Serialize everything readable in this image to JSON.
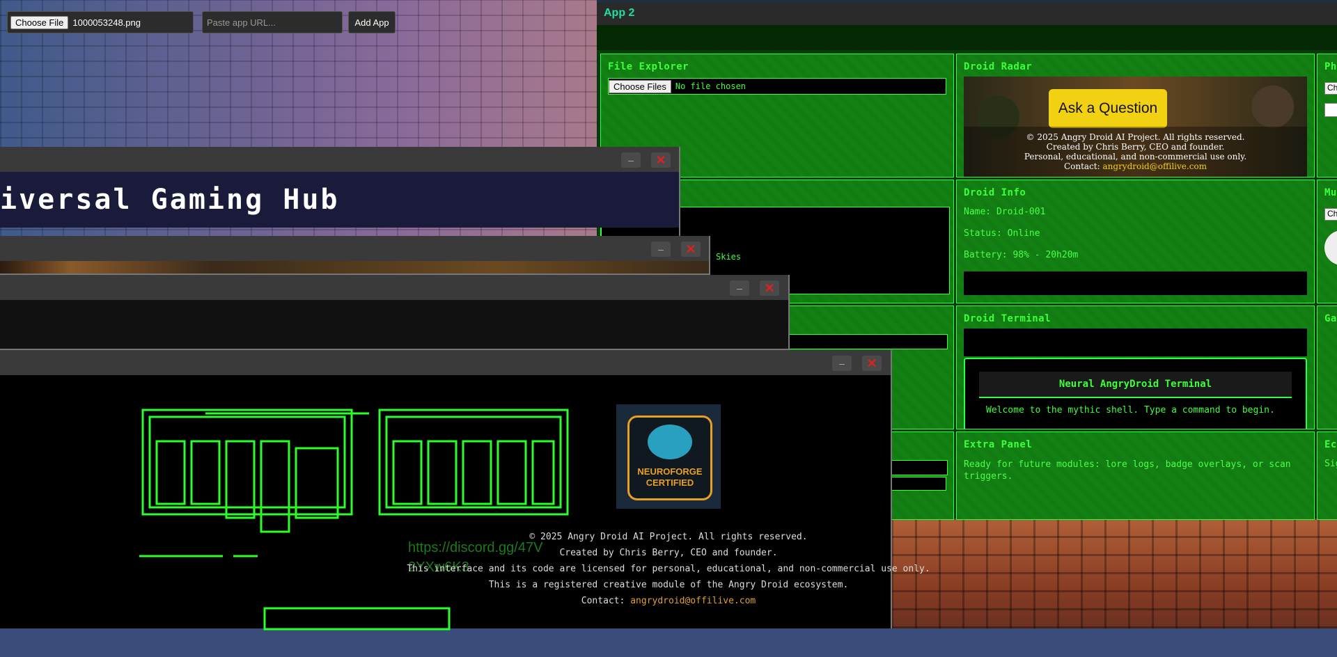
{
  "toolbar": {
    "file_button": "Choose File",
    "file_name": "1000053248.png",
    "url_placeholder": "Paste app URL...",
    "add_button": "Add App"
  },
  "app2": {
    "title": "App 2",
    "panels": {
      "file_explorer": {
        "title": "File Explorer",
        "button": "Choose Files",
        "file_status": "No file chosen"
      },
      "droid_radar": {
        "title": "Droid Radar",
        "ask_button": "Ask a Question",
        "footer_line1": "© 2025 Angry Droid AI Project. All rights reserved.",
        "footer_line2": "Created by Chris Berry, CEO and founder.",
        "footer_line3": "Personal, educational, and non-commercial use only.",
        "footer_contact_label": "Contact:",
        "footer_contact_email": "angrydroid@offilive.com"
      },
      "photo_partial": {
        "title": "Pho",
        "input": "Che"
      },
      "droid_info": {
        "title": "Droid Info",
        "name": "Name: Droid-001",
        "status": "Status: Online",
        "battery": "Battery: 98% - 20h20m"
      },
      "music_partial": {
        "title": "Mus",
        "input": "Che"
      },
      "droid_terminal": {
        "title": "Droid Terminal",
        "header": "Neural AngryDroid Terminal",
        "welcome": "Welcome to the mythic shell. Type a command to begin."
      },
      "game_partial": {
        "title": "Gam"
      },
      "extra_panel": {
        "title": "Extra Panel",
        "text": "Ready for future modules: lore logs, badge overlays, or scan triggers."
      },
      "echo_partial": {
        "title": "Ech",
        "text": "Sig"
      },
      "hidden_panel_text": "Skies"
    }
  },
  "windows": {
    "hub": {
      "title_text": "iversal Gaming Hub",
      "min": "–",
      "close": "✕"
    },
    "w2": {
      "min": "–",
      "close": "✕"
    },
    "w3": {
      "min": "–",
      "close": "✕"
    },
    "w4": {
      "min": "–",
      "close": "✕"
    }
  },
  "angry_droid": {
    "discord": "https://discord.gg/47V",
    "discord_cont": "2YXw6K3",
    "badge_top": "NEUROFORGE",
    "badge_bottom": "CERTIFIED",
    "footer_line1": "© 2025 Angry Droid AI Project. All rights reserved.",
    "footer_line2": "Created by Chris Berry, CEO and founder.",
    "footer_line3": "This interface and its code are licensed for personal, educational, and non-commercial use only.",
    "footer_line4": "This is a registered creative module of the Angry Droid ecosystem.",
    "footer_contact_label": "Contact:",
    "footer_contact_email": "angrydroid@offilive.com"
  },
  "colors": {
    "terminal_green": "#3dff3d",
    "accent_yellow": "#f2d012",
    "close_red": "#e02020"
  }
}
